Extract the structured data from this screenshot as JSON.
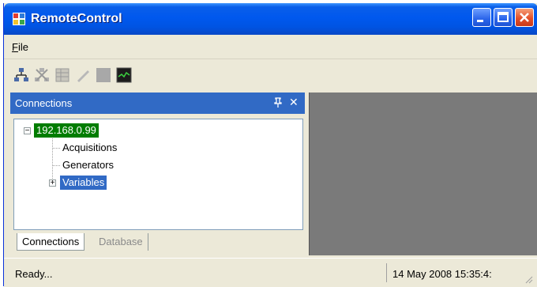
{
  "window": {
    "title": "RemoteControl"
  },
  "menu": {
    "file": "File"
  },
  "toolbar": {
    "icons": [
      "network-icon",
      "disconnect-icon",
      "table-icon",
      "pencil-icon",
      "stop-icon",
      "scope-icon"
    ]
  },
  "panel": {
    "title": "Connections",
    "pin": "ㅁ",
    "close": "✕",
    "tree": {
      "root": "192.168.0.99",
      "children": [
        "Acquisitions",
        "Generators",
        "Variables"
      ]
    },
    "tabs": [
      "Connections",
      "Database"
    ]
  },
  "status": {
    "message": "Ready...",
    "timestamp": "14 May 2008 15:35:4:"
  },
  "colors": {
    "titlebar": "#0054e3",
    "selection": "#316ac5",
    "root_node": "#007d00",
    "workspace": "#7a7a7a"
  }
}
